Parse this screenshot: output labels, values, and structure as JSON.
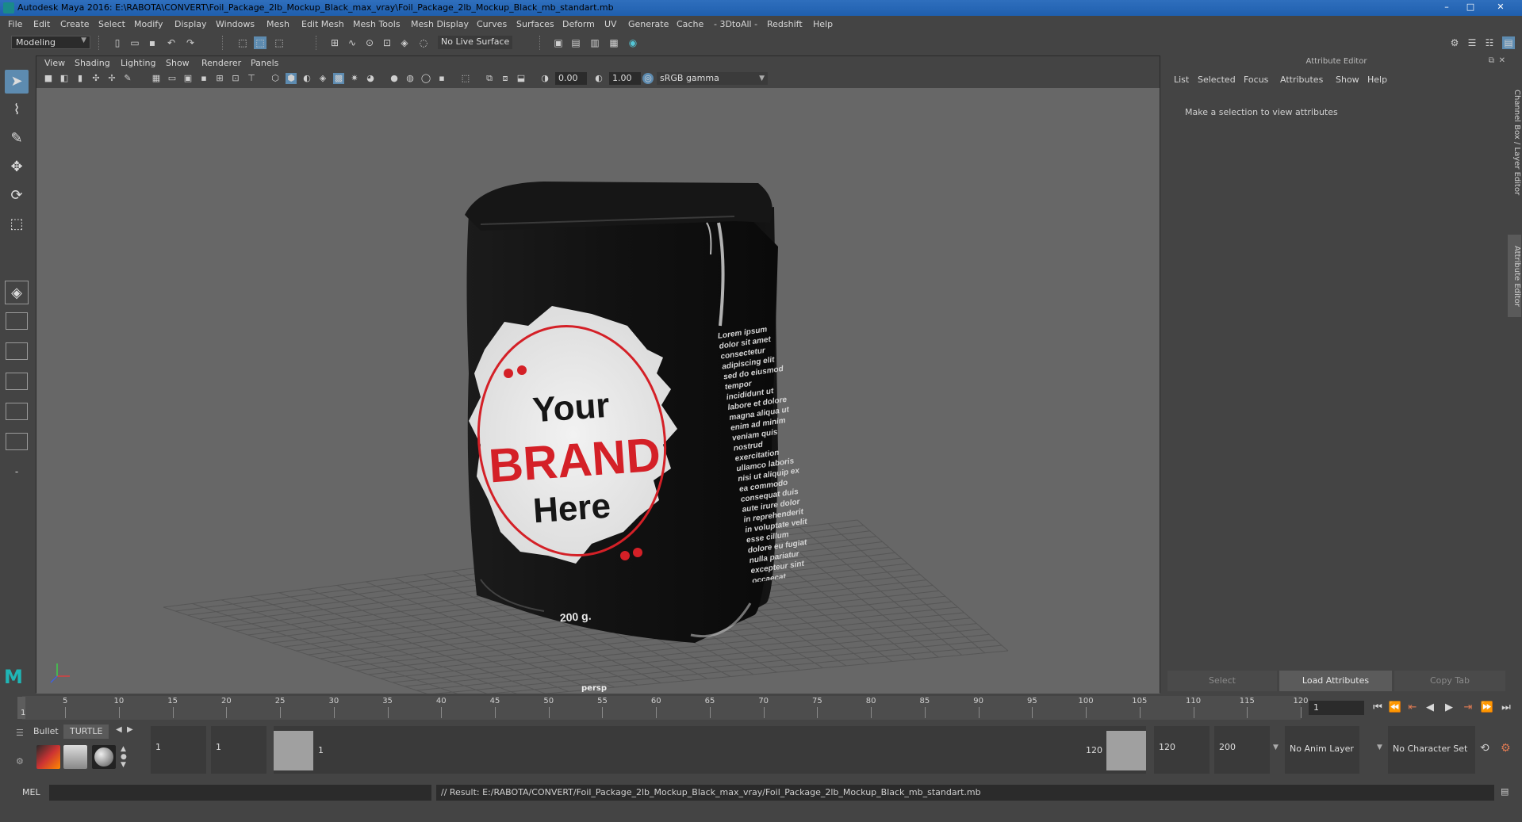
{
  "window": {
    "title": "Autodesk Maya 2016: E:\\RABOTA\\CONVERT\\Foil_Package_2lb_Mockup_Black_max_vray\\Foil_Package_2lb_Mockup_Black_mb_standart.mb",
    "minimize": "–",
    "maximize": "□",
    "close": "✕"
  },
  "menubar": [
    "File",
    "Edit",
    "Create",
    "Select",
    "Modify",
    "Display",
    "Windows",
    "Mesh",
    "Edit Mesh",
    "Mesh Tools",
    "Mesh Display",
    "Curves",
    "Surfaces",
    "Deform",
    "UV",
    "Generate",
    "Cache",
    "- 3DtoAll -",
    "Redshift",
    "Help"
  ],
  "statusline": {
    "mode": "Modeling",
    "live_surface": "No Live Surface"
  },
  "panel": {
    "menu": [
      "View",
      "Shading",
      "Lighting",
      "Show",
      "Renderer",
      "Panels"
    ],
    "exposure": "0.00",
    "gamma_value": "1.00",
    "color_space": "sRGB gamma",
    "camera_label": "persp"
  },
  "scene": {
    "label_your": "Your",
    "label_brand": "BRAND",
    "label_here": "Here",
    "weight": "200 g.",
    "side_text": "Lorem ipsum dolor sit amet consectetur adipiscing elit sed do eiusmod tempor incididunt ut labore et dolore magna aliqua ut enim ad minim veniam quis nostrud exercitation ullamco laboris nisi ut aliquip ex ea commodo consequat duis aute irure dolor in reprehenderit in voluptate velit esse cillum dolore eu fugiat nulla pariatur excepteur sint occaecat cupidatat non proident sunt in culpa qui officia deserunt",
    "brand_color": "#d42027",
    "package_color": "#0c0c0c"
  },
  "attribute_editor": {
    "title": "Attribute Editor",
    "menu": [
      "List",
      "Selected",
      "Focus",
      "Attributes",
      "Show",
      "Help"
    ],
    "message": "Make a selection to view attributes",
    "buttons": {
      "select": "Select",
      "load": "Load Attributes",
      "copy": "Copy Tab"
    },
    "side_tabs": [
      "Channel Box / Layer Editor",
      "Attribute Editor"
    ]
  },
  "timeslider": {
    "ticks": [
      "5",
      "10",
      "15",
      "20",
      "25",
      "30",
      "35",
      "40",
      "45",
      "50",
      "55",
      "60",
      "65",
      "70",
      "75",
      "80",
      "85",
      "90",
      "95",
      "100",
      "105",
      "110",
      "115",
      "120"
    ],
    "current_frame_marker": "1",
    "current_frame": "1"
  },
  "shelf": {
    "tabs": [
      "Bullet",
      "TURTLE"
    ]
  },
  "range": {
    "start": "1",
    "playback_start": "1",
    "bar_start": "1",
    "bar_end": "120",
    "playback_end": "120",
    "end": "200",
    "anim_layer": "No Anim Layer",
    "character_set": "No Character Set"
  },
  "cmdline": {
    "label": "MEL",
    "result": "// Result: E:/RABOTA/CONVERT/Foil_Package_2lb_Mockup_Black_max_vray/Foil_Package_2lb_Mockup_Black_mb_standart.mb"
  }
}
